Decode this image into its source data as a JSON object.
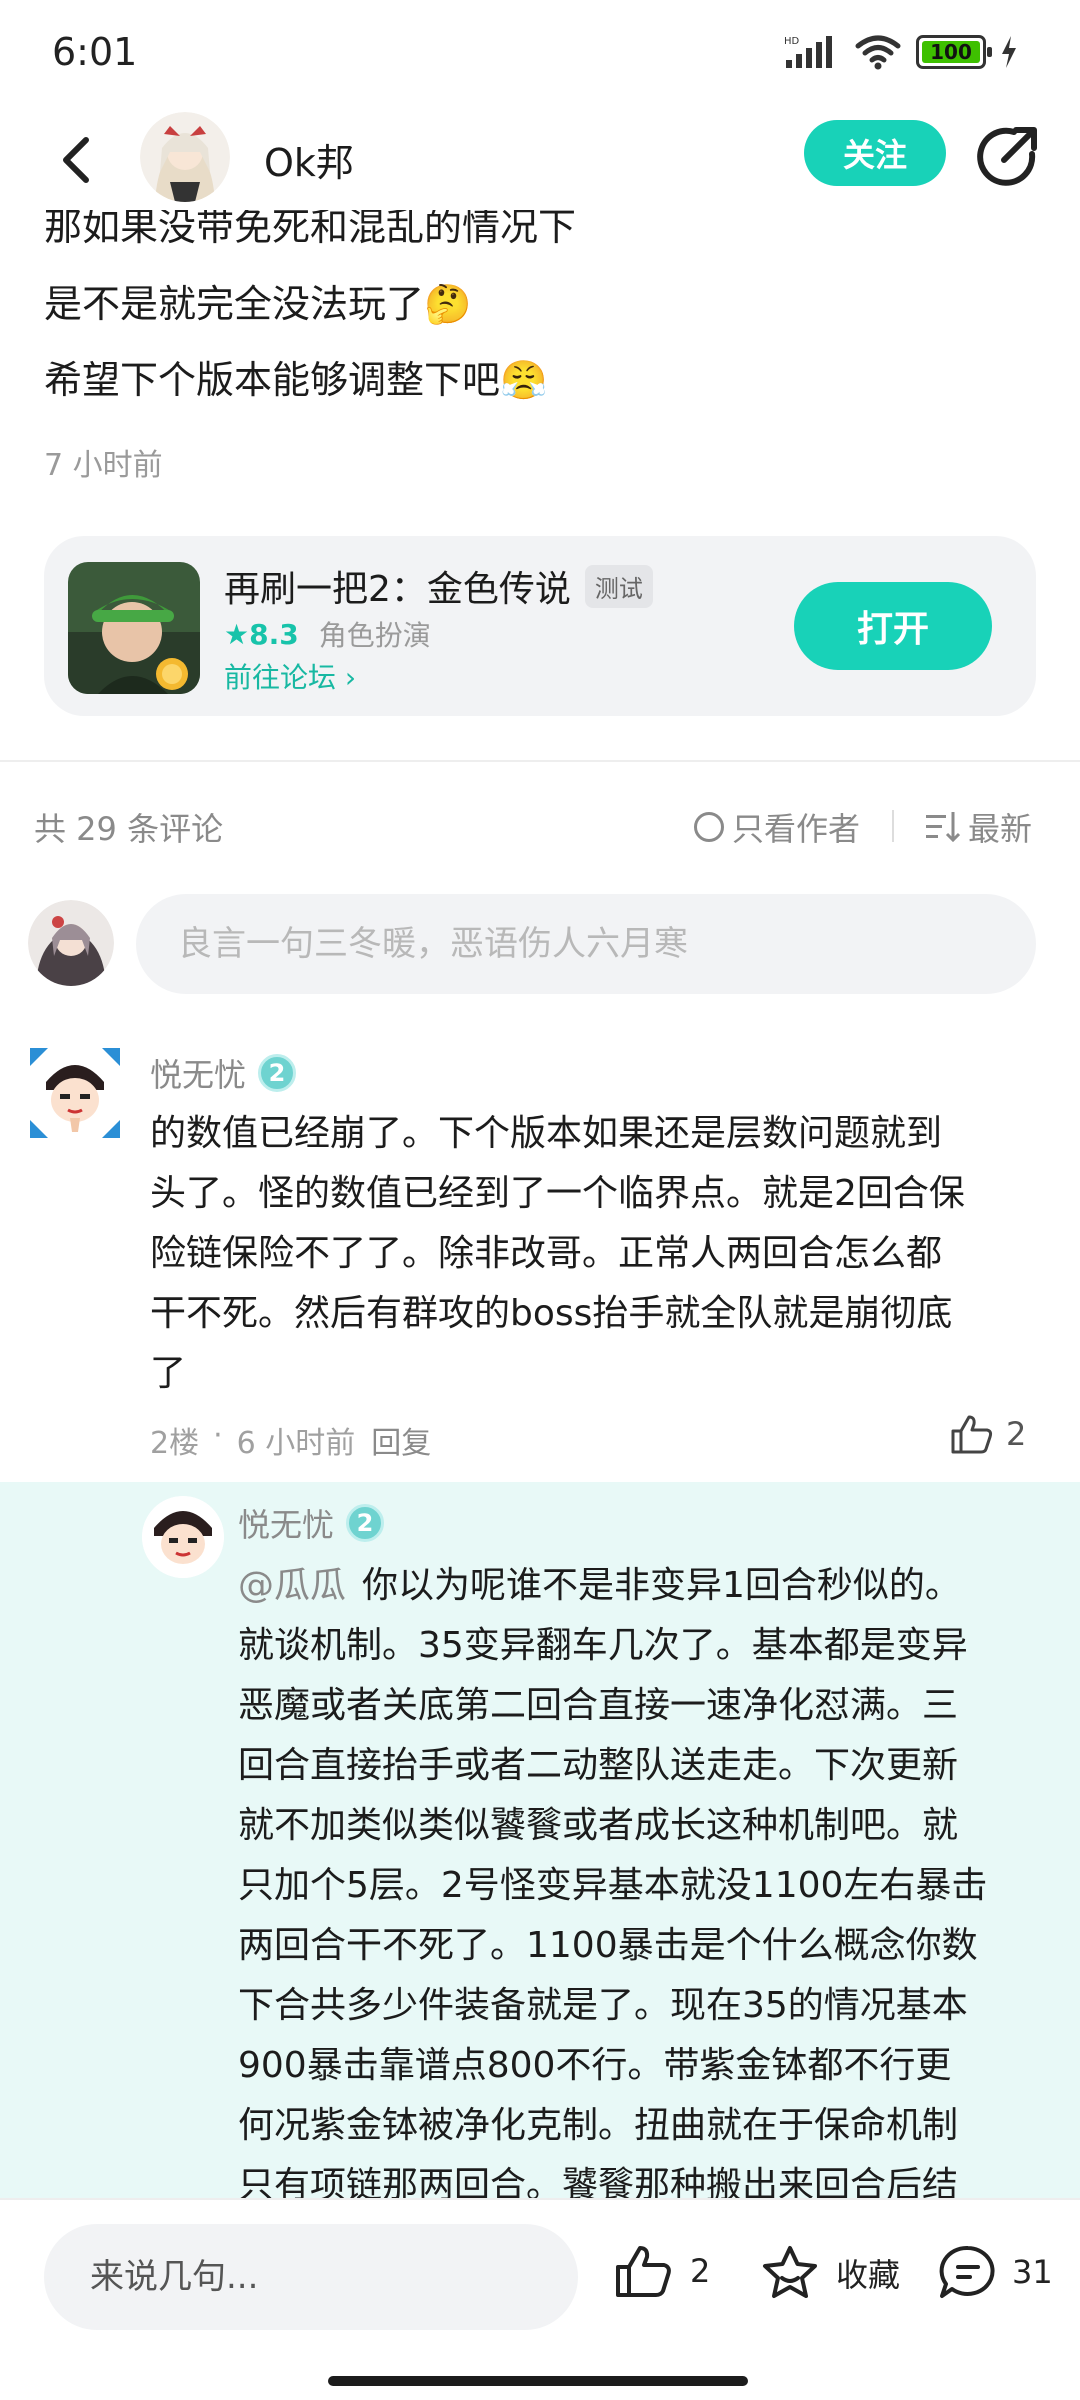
{
  "status_bar": {
    "time": "6:01",
    "battery": "100"
  },
  "header": {
    "author": "Ok邦",
    "follow_label": "关注"
  },
  "post": {
    "lines": [
      "那如果没带免死和混乱的情况下",
      "是不是就完全没法玩了🤔",
      "希望下个版本能够调整下吧😤"
    ],
    "time_ago": "7 小时前"
  },
  "game_card": {
    "title": "再刷一把2：金色传说",
    "tag": "测试",
    "rating": "8.3",
    "genre": "角色扮演",
    "forum_link": "前往论坛",
    "open_label": "打开"
  },
  "comments_header": {
    "count": "共 29 条评论",
    "only_author": "只看作者",
    "sort": "最新"
  },
  "comment_input": {
    "placeholder": "良言一句三冬暖，恶语伤人六月寒"
  },
  "comment1": {
    "user": "悦无忧",
    "level": "2",
    "lines": [
      "的数值已经崩了。下个版本如果还是层数问题就到",
      "头了。怪的数值已经到了一个临界点。就是2回合保",
      "险链保险不了了。除非改哥。正常人两回合怎么都",
      "干不死。然后有群攻的boss抬手就全队就是崩彻底",
      "了"
    ],
    "floor": "2楼",
    "dot": "·",
    "time": "6 小时前",
    "reply_label": "回复",
    "likes": "2"
  },
  "reply1": {
    "user": "悦无忧",
    "level": "2",
    "mention": "@瓜瓜",
    "first_line": "你以为呢谁不是非变异1回合秒似的。",
    "lines": [
      "就谈机制。35变异翻车几次了。基本都是变异",
      "恶魔或者关底第二回合直接一速净化怼满。三",
      "回合直接抬手或者二动整队送走走。下次更新",
      "就不加类似类似饕餮或者成长这种机制吧。就",
      "只加个5层。2号怪变异基本就没1100左右暴击",
      "两回合干不死了。1100暴击是个什么概念你数",
      "下合共多少件装备就是了。现在35的情况基本",
      "900暴击靠谱点800不行。带紫金钵都不行更",
      "何况紫金钵被净化克制。扭曲就在于保命机制",
      "只有项链那两回合。饕餮那种搬出来回合后结"
    ]
  },
  "bottom_bar": {
    "input_placeholder": "来说几句...",
    "likes": "2",
    "favorite_label": "收藏",
    "comments": "31"
  }
}
